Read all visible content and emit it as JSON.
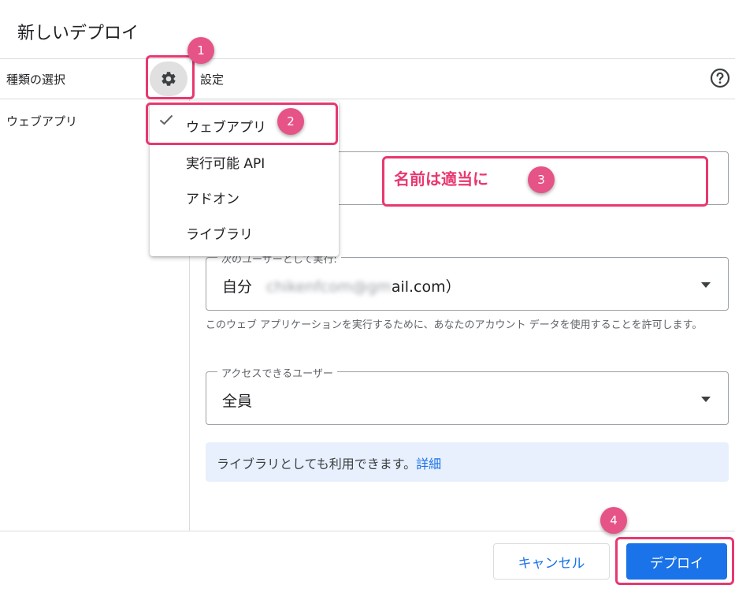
{
  "dialog": {
    "title": "新しいデプロイ"
  },
  "sidebar": {
    "type_select_label": "種類の選択",
    "selected_type": "ウェブアプリ"
  },
  "settings": {
    "title": "設定"
  },
  "type_menu": {
    "items": [
      {
        "label": "ウェブアプリ",
        "checked": true
      },
      {
        "label": "実行可能 API",
        "checked": false
      },
      {
        "label": "アドオン",
        "checked": false
      },
      {
        "label": "ライブラリ",
        "checked": false
      }
    ]
  },
  "execute_as": {
    "legend": "次のユーザーとして実行:",
    "value_prefix": "自分",
    "value_email_blurred": "chikenfcom@gm",
    "value_suffix": "ail.com）",
    "helper": "このウェブ アプリケーションを実行するために、あなたのアカウント データを使用することを許可します。"
  },
  "access": {
    "legend": "アクセスできるユーザー",
    "value": "全員"
  },
  "info": {
    "text": "ライブラリとしても利用できます。",
    "link": "詳細"
  },
  "footer": {
    "cancel_label": "キャンセル",
    "deploy_label": "デプロイ"
  },
  "annotations": {
    "badges": [
      "1",
      "2",
      "3",
      "4"
    ],
    "name_note": "名前は適当に"
  },
  "colors": {
    "accent": "#1a73e8",
    "annotation": "#e8386f",
    "info_bg": "#e8f0fe"
  },
  "icons": [
    "gear-icon",
    "help-icon",
    "check-icon",
    "dropdown-caret-icon"
  ]
}
